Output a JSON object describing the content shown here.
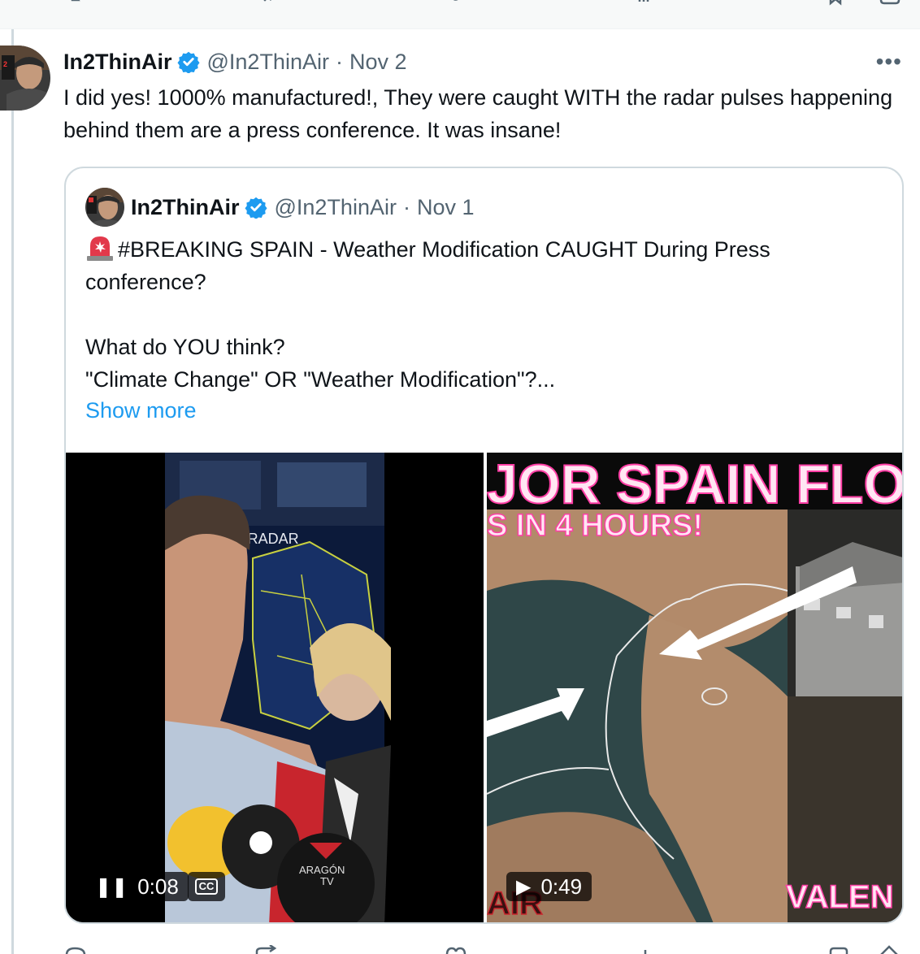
{
  "reply": {
    "author_name": "In2ThinAir",
    "handle": "@In2ThinAir",
    "separator": "·",
    "date": "Nov 2",
    "more_label": "•••",
    "text": "I did yes! 1000% manufactured!, They were caught WITH the radar pulses happening behind them are a press conference. It was insane!"
  },
  "quoted": {
    "author_name": "In2ThinAir",
    "handle": "@In2ThinAir",
    "separator": "·",
    "date": "Nov 1",
    "text_line1": "#BREAKING SPAIN - Weather Modification CAUGHT During Press conference?",
    "text_line2": "What do YOU think?",
    "text_line3": "\"Climate Change\" OR \"Weather Modification\"?...",
    "show_more": "Show more",
    "media": [
      {
        "state_icon": "pause",
        "state_glyph": "❚❚",
        "time": "0:08",
        "cc_label": "CC",
        "overlay_texts": [
          "T RADAR",
          "ARAGÓN",
          "TV"
        ]
      },
      {
        "state_icon": "play",
        "state_glyph": "▶",
        "time": "0:49",
        "overlay_texts": [
          "JOR SPAIN FLO",
          "S IN 4 HOURS!",
          "VALEN",
          "AIR"
        ]
      }
    ]
  },
  "colors": {
    "link_blue": "#1d9bf0",
    "verified_blue": "#1d9bf0",
    "secondary_text": "#536471",
    "border": "#cfd9de",
    "neon_pink": "#ff3ea5"
  },
  "icons": [
    "verified-badge-icon",
    "more-icon",
    "siren-emoji-icon",
    "pause-icon",
    "play-icon",
    "closed-captions-icon",
    "reply-icon",
    "retweet-icon",
    "like-icon",
    "views-icon",
    "bookmark-icon",
    "share-icon"
  ]
}
